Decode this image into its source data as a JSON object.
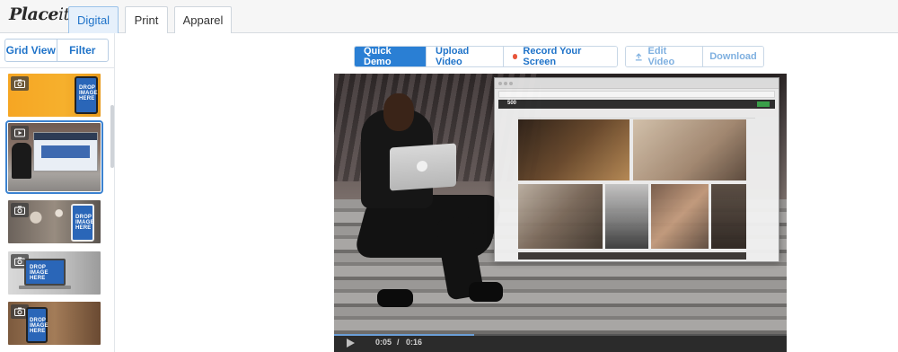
{
  "header": {
    "logo": {
      "main": "Place",
      "suffix": "it"
    },
    "tabs": [
      {
        "label": "Digital",
        "active": true
      },
      {
        "label": "Print",
        "active": false
      },
      {
        "label": "Apparel",
        "active": false
      }
    ]
  },
  "sidebar": {
    "grid_view_label": "Grid View",
    "filter_label": "Filter",
    "thumbnails": [
      {
        "type": "photo",
        "icon": "camera-icon",
        "overlay_text": [
          "DROP",
          "IMAGE",
          "HERE"
        ]
      },
      {
        "type": "video",
        "icon": "video-icon",
        "selected": true
      },
      {
        "type": "photo",
        "icon": "camera-icon",
        "overlay_text": [
          "DROP",
          "IMAGE",
          "HERE"
        ]
      },
      {
        "type": "photo",
        "icon": "camera-icon",
        "overlay_text": [
          "DROP",
          "IMAGE",
          "HERE"
        ]
      },
      {
        "type": "photo",
        "icon": "camera-icon",
        "overlay_text": [
          "DROP",
          "IMAGE",
          "HERE"
        ]
      }
    ]
  },
  "toolbar": {
    "quick_demo": "Quick Demo",
    "upload_video": "Upload Video",
    "record_screen": "Record Your Screen",
    "edit_video": "Edit Video",
    "download": "Download"
  },
  "video": {
    "current_time": "0:05",
    "separator": "/",
    "duration": "0:16",
    "progress": 0.31,
    "screen_brand": "500"
  },
  "colors": {
    "accent": "#2a7fd4",
    "link": "#1f73c9",
    "record_dot": "#e8553a"
  }
}
